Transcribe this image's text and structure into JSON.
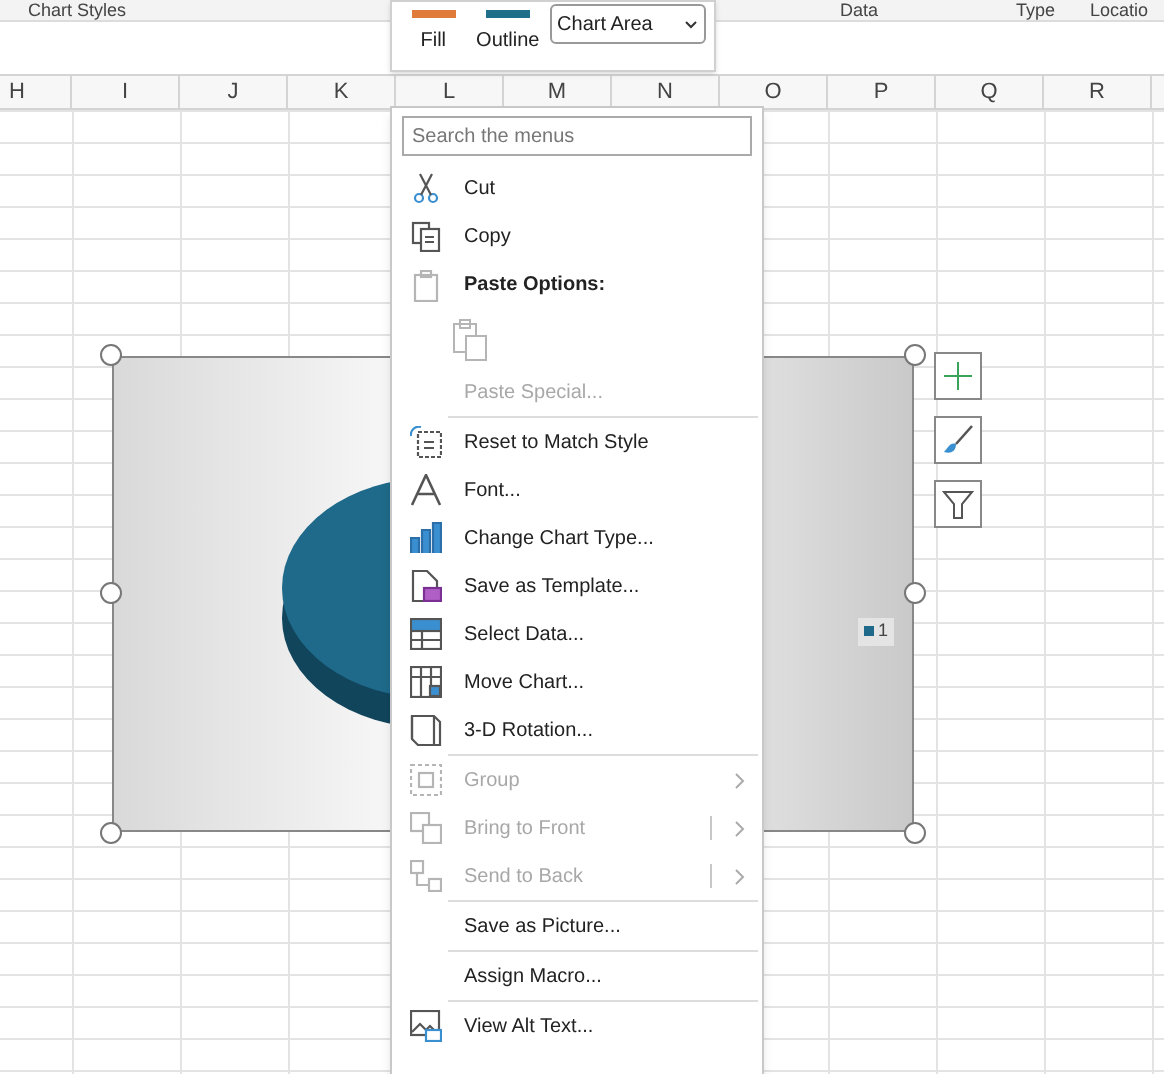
{
  "ribbon": {
    "group_labels": [
      {
        "label": "Chart Styles"
      },
      {
        "label": "Data"
      },
      {
        "label": "Type"
      },
      {
        "label": "Locatio"
      }
    ]
  },
  "mini_toolbar": {
    "buttons": [
      {
        "label": "Fill",
        "color": "#e07b39"
      },
      {
        "label": "Outline",
        "color": "#1f6f8b"
      }
    ],
    "element_select": {
      "value": "Chart Area"
    }
  },
  "columns": [
    "H",
    "I",
    "J",
    "K",
    "L",
    "M",
    "N",
    "O",
    "P",
    "Q",
    "R"
  ],
  "chart": {
    "legend": "1",
    "selected": true
  },
  "context_menu": {
    "search": {
      "placeholder": "Search the menus"
    },
    "items": [
      {
        "kind": "item",
        "label": "Cut",
        "disabled": false
      },
      {
        "kind": "item",
        "label": "Copy",
        "disabled": false
      },
      {
        "kind": "heading",
        "label": "Paste Options:"
      },
      {
        "kind": "paste"
      },
      {
        "kind": "item",
        "label": "Paste Special...",
        "disabled": true
      },
      {
        "kind": "divider"
      },
      {
        "kind": "item",
        "label": "Reset to Match Style",
        "disabled": false
      },
      {
        "kind": "item",
        "label": "Font...",
        "disabled": false
      },
      {
        "kind": "item",
        "label": "Change Chart Type...",
        "disabled": false
      },
      {
        "kind": "item",
        "label": "Save as Template...",
        "disabled": false
      },
      {
        "kind": "item",
        "label": "Select Data...",
        "disabled": false
      },
      {
        "kind": "item",
        "label": "Move Chart...",
        "disabled": false
      },
      {
        "kind": "item",
        "label": "3-D Rotation...",
        "disabled": false
      },
      {
        "kind": "divider"
      },
      {
        "kind": "item",
        "label": "Group",
        "disabled": true,
        "submenu": true,
        "split": false
      },
      {
        "kind": "item",
        "label": "Bring to Front",
        "disabled": true,
        "submenu": true,
        "split": true
      },
      {
        "kind": "item",
        "label": "Send to Back",
        "disabled": true,
        "submenu": true,
        "split": true
      },
      {
        "kind": "divider"
      },
      {
        "kind": "item",
        "label": "Save as Picture...",
        "disabled": false
      },
      {
        "kind": "divider"
      },
      {
        "kind": "item",
        "label": "Assign Macro...",
        "disabled": false
      },
      {
        "kind": "divider"
      },
      {
        "kind": "item",
        "label": "View Alt Text...",
        "disabled": false
      }
    ]
  }
}
